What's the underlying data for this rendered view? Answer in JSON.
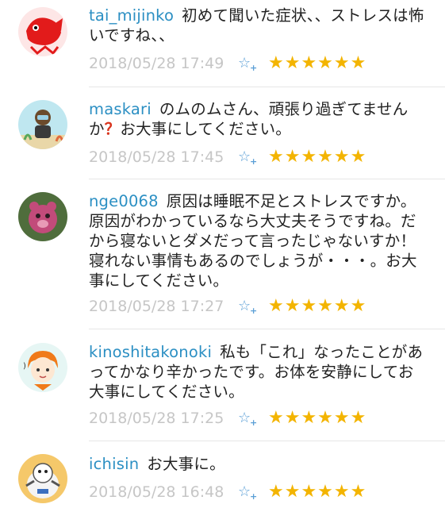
{
  "comments": [
    {
      "user": "tai_mijinko",
      "text": "初めて聞いた症状、、ストレスは怖いですね、、",
      "date": "2018/05/28 17:49",
      "stars": "★★★★★★"
    },
    {
      "user": "maskari",
      "text_a": "のムのムさん、頑張り過ぎてませんか",
      "question": "？",
      "text_b": "お大事にしてください。",
      "date": "2018/05/28 17:45",
      "stars": "★★★★★★"
    },
    {
      "user": "nge0068",
      "text": "原因は睡眠不足とストレスですか。原因がわかっているなら大丈夫そうですね。だから寝ないとダメだって言ったじゃないすか！寝れない事情もあるのでしょうが・・・。お大事にしてください。",
      "date": "2018/05/28 17:27",
      "stars": "★★★★★★"
    },
    {
      "user": "kinoshitakonoki",
      "text": "私も「これ」なったことがあってかなり辛かったです。お体を安静にしてお大事にしてください。",
      "date": "2018/05/28 17:25",
      "stars": "★★★★★★"
    },
    {
      "user": "ichisin",
      "text": "お大事に。",
      "date": "2018/05/28 16:48",
      "stars": "★★★★★★"
    }
  ],
  "icons": {
    "favorite": "star-plus-icon",
    "rating": "star-icon"
  },
  "colors": {
    "username": "#2b8fc3",
    "date": "#c6c6c6",
    "stars": "#f3b400",
    "favorite": "#5b9fd6",
    "question": "#d9351e"
  }
}
